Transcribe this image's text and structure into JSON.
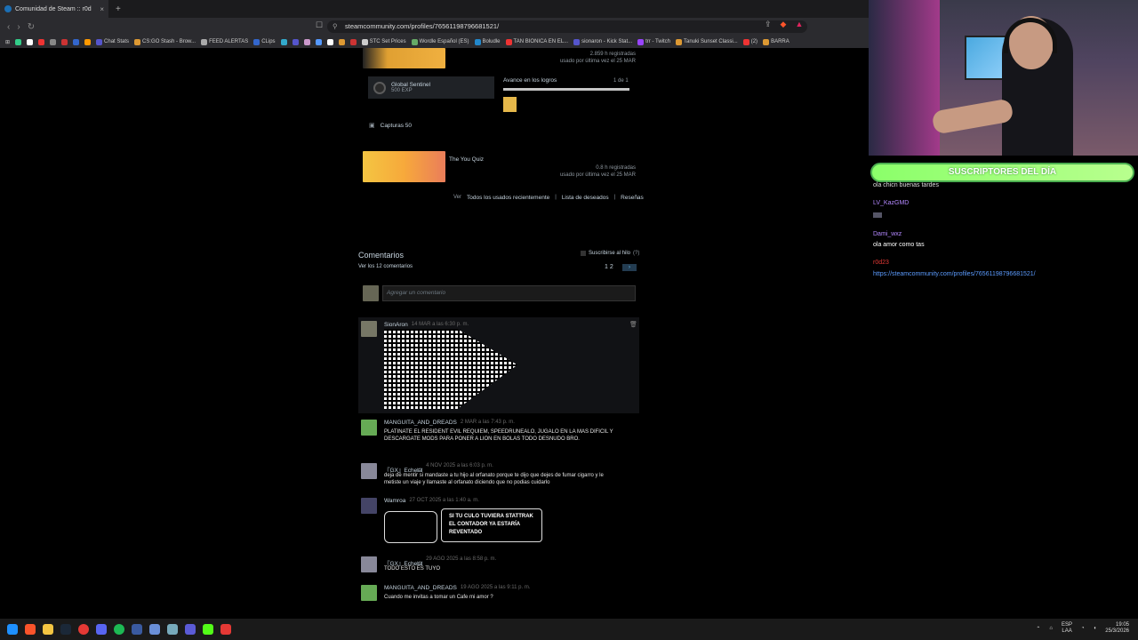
{
  "browser": {
    "tab_title": "Comunidad de Steam :: r0d",
    "new_tab": "+",
    "close": "×",
    "url": "steamcommunity.com/profiles/76561198796681521/",
    "bookmarks": [
      "Chat Stats",
      "CS:GO Stash - Brow...",
      "FEED ALERTAS",
      "CLips",
      "STC Set Prices",
      "Wordle Español (ES)",
      "Boludle",
      "TAN BIONICA EN EL...",
      "sionaron - Kick Stat...",
      "trr - Twitch",
      "Tanuki Sunset Classi...",
      "(2)",
      "BARRA"
    ]
  },
  "games": [
    {
      "hours": "2.859 h registradas",
      "last": "usado por última vez el 25 MAR"
    },
    {
      "title": "The You Quiz",
      "hours": "0.8 h registradas",
      "last": "usado por última vez el 25 MAR"
    }
  ],
  "achievement": {
    "name": "Global Sentinel",
    "exp": "500 EXP",
    "progress_label": "Avance en los logros",
    "progress_count": "1 de 1",
    "progress_value": 1.0
  },
  "screenshots": "Capturas 50",
  "links": {
    "ver": "Ver",
    "recent": "Todos los usados recientemente",
    "wishlist": "Lista de deseados",
    "reviews": "Reseñas"
  },
  "comments": {
    "title": "Comentarios",
    "view_all": "Ver los 12 comentarios",
    "subscribe": "Suscribirse al hilo",
    "subscribe_note": "(?)",
    "pages": "1 2",
    "placeholder": "Agregar un comentario",
    "items": [
      {
        "author": "SionAron",
        "date": "14 MAR a las 6:30 p. m.",
        "text": ""
      },
      {
        "author": "MANGUITA_AND_DREADS",
        "date": "2 MAR a las 7:43 p. m.",
        "text": "PLATINATE EL RESIDENT EVIL REQUIEM, SPEEDRUNEALO, JUGALO EN LA MAS DIFICIL Y DESCARGATE MODS PARA PONER A LION EN BOLAS TODO DESNUDO BRO."
      },
      {
        "author": "『GX』Eche🜲",
        "date": "4 NOV 2025 a las 6:03 p. m.",
        "text": "deja de mentir si mandaste a tu hijo al orfanato porque te dijo que dejes de fumar cigarro y le metiste un viaje y llamaste al orfanato diciendo que no podias cuidarlo"
      },
      {
        "author": "Wamroa",
        "date": "27 OCT 2025 a las 1:40 a. m.",
        "text": ""
      },
      {
        "author": "『GX』Eche🜲",
        "date": "29 AGO 2025 a las 8:58 p. m.",
        "text": "TODO ESTO ES TUYO"
      },
      {
        "author": "MANGUITA_AND_DREADS",
        "date": "19 AGO 2025 a las 9:11 p. m.",
        "text": "Cuando me invitas a tomar un Cafe mi amor ?"
      }
    ],
    "ascii_bubble": "SI TU CULO TUVIERA STATTRAK\nEL CONTADOR YA ESTARÍA\nREVENTADO"
  },
  "overlay": {
    "subs_title": "SUSCRIPTORES DEL DÍA",
    "chat": [
      {
        "user": "",
        "msg": "ola chicn buenas tardes"
      },
      {
        "user": "LV_KazGMD",
        "msg": ""
      },
      {
        "user": "Dami_wxz",
        "msg": "ola amor como tas"
      },
      {
        "user": "r0d23",
        "msg": "https://steamcommunity.com/profiles/76561198796681521/"
      }
    ]
  },
  "taskbar": {
    "lang": "ESP",
    "lang2": "LAA",
    "time": "19:05",
    "date": "25/3/2026"
  }
}
